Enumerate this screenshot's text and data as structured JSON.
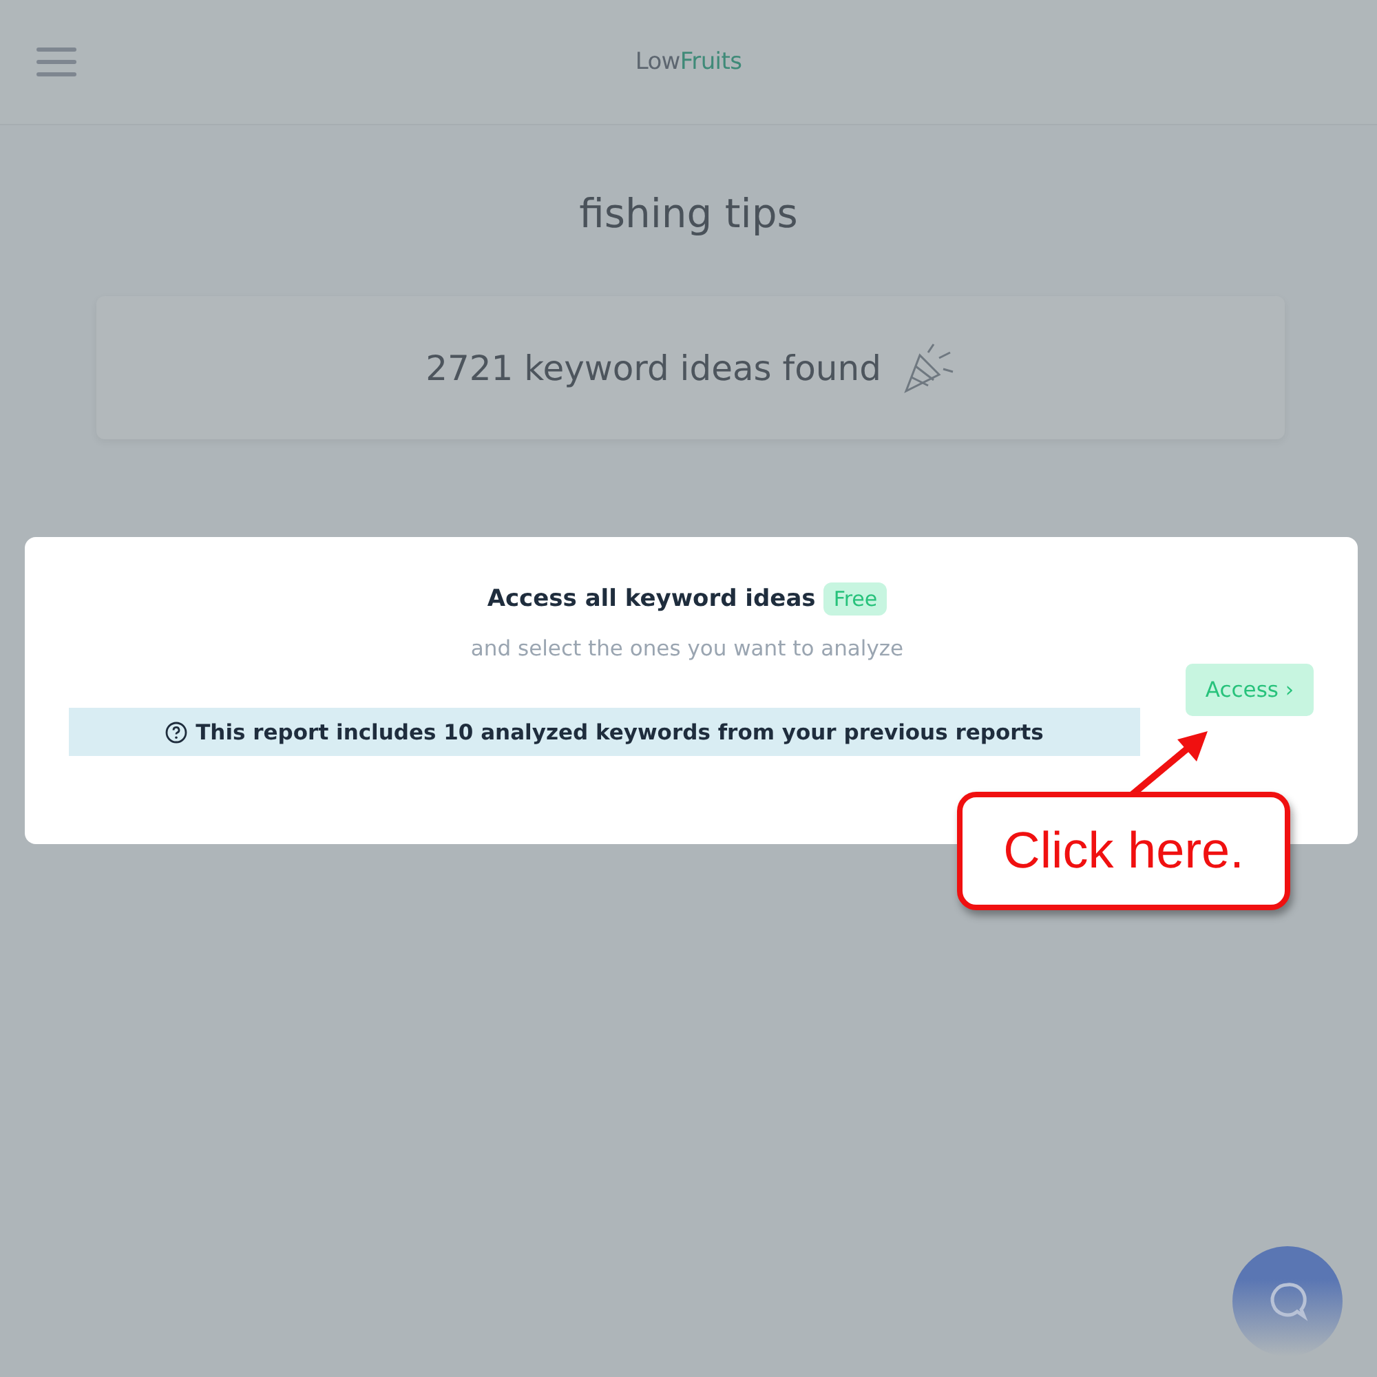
{
  "header": {
    "logo": {
      "primary": "Low",
      "accent": "Fruits"
    }
  },
  "page_title": "fishing tips",
  "result_card": {
    "text": "2721 keyword ideas found"
  },
  "modal": {
    "title": "Access all keyword ideas",
    "badge": "Free",
    "subtitle": "and select the ones you want to analyze",
    "info": "This report includes 10 analyzed keywords from your previous reports",
    "button": "Access ›"
  },
  "callout": {
    "text": "Click here."
  }
}
